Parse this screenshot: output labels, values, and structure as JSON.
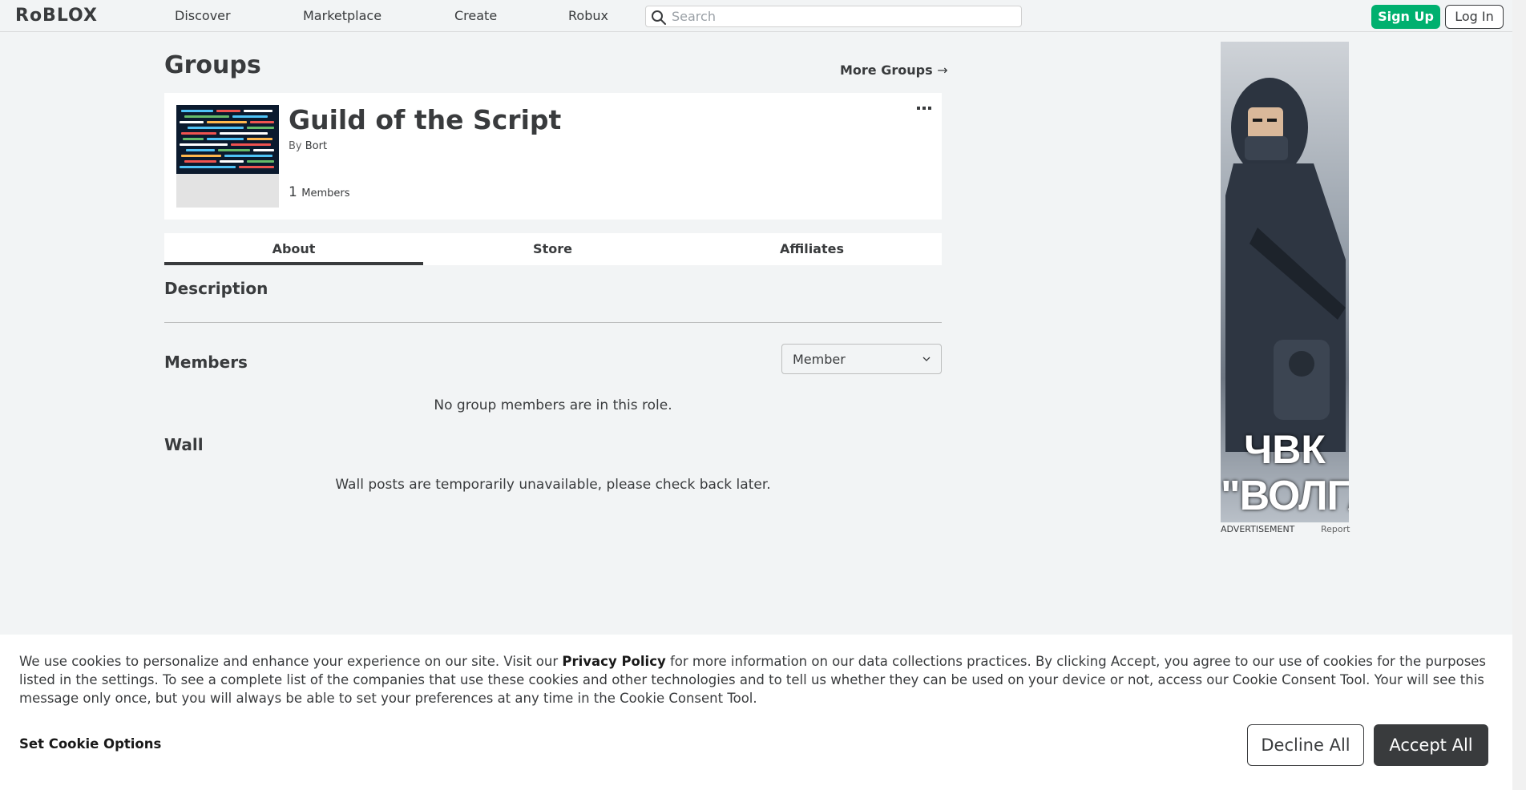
{
  "header": {
    "logo": "RᴏBLOX",
    "nav": [
      "Discover",
      "Marketplace",
      "Create",
      "Robux"
    ],
    "search_placeholder": "Search",
    "signup_label": "Sign Up",
    "login_label": "Log In"
  },
  "page": {
    "title": "Groups",
    "more_groups": "More Groups",
    "more_groups_arrow": "→"
  },
  "group": {
    "name": "Guild of the Script",
    "by_label": "By",
    "owner": "Bort",
    "member_count": "1",
    "members_label": "Members"
  },
  "tabs": [
    {
      "label": "About",
      "active": true
    },
    {
      "label": "Store",
      "active": false
    },
    {
      "label": "Affiliates",
      "active": false
    }
  ],
  "about": {
    "description_heading": "Description",
    "members_heading": "Members",
    "role_selected": "Member",
    "members_empty": "No group members are in this role.",
    "wall_heading": "Wall",
    "wall_message": "Wall posts are temporarily unavailable, please check back later."
  },
  "ad": {
    "text_line1": "ЧВК",
    "text_line2": "\"ВОЛГА\"",
    "label": "ADVERTISEMENT",
    "report": "Report"
  },
  "cookie": {
    "text_before_link": "We use cookies to personalize and enhance your experience on our site. Visit our ",
    "link_text": "Privacy Policy",
    "text_after_link": " for more information on our data collections practices. By clicking Accept, you agree to our use of cookies for the purposes listed in the settings. To see a complete list of the companies that use these cookies and other technologies and to tell us whether they can be used on your device or not, access our Cookie Consent Tool. Your will see this message only once, but you will always be able to set your preferences at any time in the Cookie Consent Tool.",
    "set_options": "Set Cookie Options",
    "decline": "Decline All",
    "accept": "Accept All"
  },
  "colors": {
    "accent_green": "#00b06f",
    "text": "#393b3d",
    "background": "#f2f4f5"
  }
}
